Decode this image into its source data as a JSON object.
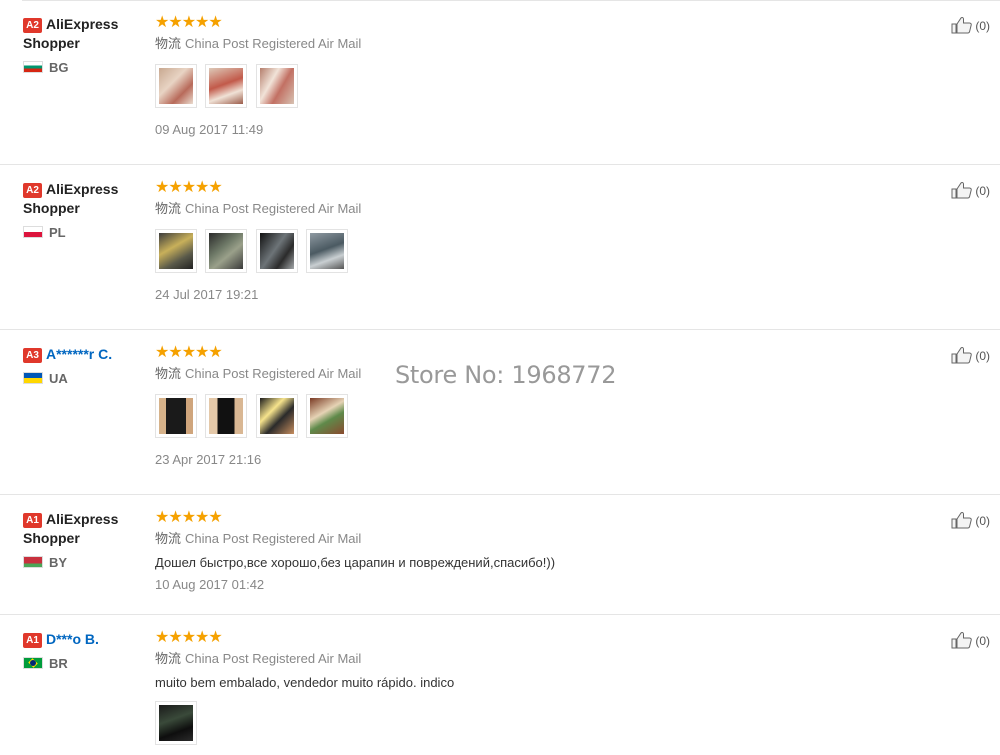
{
  "watermark": "Store No: 1968772",
  "reviews": [
    {
      "level": "A2",
      "buyer_line1": "AliExpress",
      "buyer_line2": "Shopper",
      "country": "BG",
      "stars": "★★★★★",
      "shipping_label": "物流",
      "shipping": "China Post Registered Air Mail",
      "photos": [
        "package",
        "package",
        "package"
      ],
      "text": "",
      "date": "09 Aug 2017 11:49",
      "helpful": "(0)"
    },
    {
      "level": "A2",
      "buyer_line1": "AliExpress",
      "buyer_line2": "Shopper",
      "country": "PL",
      "stars": "★★★★★",
      "shipping_label": "物流",
      "shipping": "China Post Registered Air Mail",
      "photos": [
        "glass",
        "glass",
        "glass",
        "glass"
      ],
      "text": "",
      "date": "24 Jul 2017 19:21",
      "helpful": "(0)"
    },
    {
      "level": "A3",
      "buyer_line1": "A******r C.",
      "buyer_line2": "",
      "country": "UA",
      "stars": "★★★★★",
      "shipping_label": "物流",
      "shipping": "China Post Registered Air Mail",
      "photos": [
        "device",
        "device",
        "device",
        "device"
      ],
      "text": "",
      "date": "23 Apr 2017 21:16",
      "helpful": "(0)"
    },
    {
      "level": "A1",
      "buyer_line1": "AliExpress",
      "buyer_line2": "Shopper",
      "country": "BY",
      "stars": "★★★★★",
      "shipping_label": "物流",
      "shipping": "China Post Registered Air Mail",
      "photos": [],
      "text": "Дошел быстро,все хорошо,без царапин и повреждений,спасибо!))",
      "date": "10 Aug 2017 01:42",
      "helpful": "(0)"
    },
    {
      "level": "A1",
      "buyer_line1": "D***o B.",
      "buyer_line2": "",
      "country": "BR",
      "stars": "★★★★★",
      "shipping_label": "物流",
      "shipping": "China Post Registered Air Mail",
      "photos": [
        "device"
      ],
      "text": "muito bem embalado, vendedor muito rápido. indico",
      "date": "",
      "helpful": "(0)"
    }
  ]
}
